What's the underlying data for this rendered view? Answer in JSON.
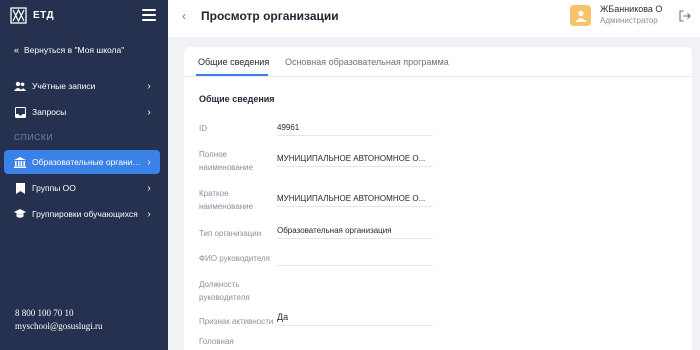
{
  "sidebar": {
    "logo_text": "ЕТД",
    "back_link": "Вернуться в \"Моя школа\"",
    "items": [
      {
        "label": "Учётные записи",
        "icon": "users-icon"
      },
      {
        "label": "Запросы",
        "icon": "inbox-icon"
      },
      {
        "label": "Образовательные организа…",
        "icon": "institution-icon",
        "active": true
      },
      {
        "label": "Группы ОО",
        "icon": "bookmark-icon"
      },
      {
        "label": "Группировки обучающихся",
        "icon": "graduation-cap-icon"
      }
    ],
    "section_title": "СПИСКИ",
    "phone": "8 800 100 70 10",
    "email": "myschool@gosuslugi.ru"
  },
  "header": {
    "title": "Просмотр организации",
    "user_name": "ЖБанникова О",
    "user_role": "Администратор"
  },
  "tabs": [
    {
      "label": "Общие сведения",
      "active": true
    },
    {
      "label": "Основная образовательная программа",
      "active": false
    }
  ],
  "form": {
    "title": "Общие сведения",
    "fields": [
      {
        "label": "ID",
        "value": "49961"
      },
      {
        "label": "Полное наименование",
        "value": "МУНИЦИПАЛЬНОЕ АВТОНОМНОЕ О..."
      },
      {
        "label": "Краткое наименование",
        "value": "МУНИЦИПАЛЬНОЕ АВТОНОМНОЕ О..."
      },
      {
        "label": "Тип организации",
        "value": "Образовательная организация"
      },
      {
        "label": "ФИО руководителя",
        "value": ""
      },
      {
        "label": "Должность руководителя",
        "value": ""
      },
      {
        "label": "Признак активности",
        "value": "Да"
      },
      {
        "label": "Головная",
        "value": ""
      }
    ]
  },
  "colors": {
    "sidebar_bg": "#25314f",
    "accent": "#3b82e8",
    "avatar": "#f6c26b"
  }
}
